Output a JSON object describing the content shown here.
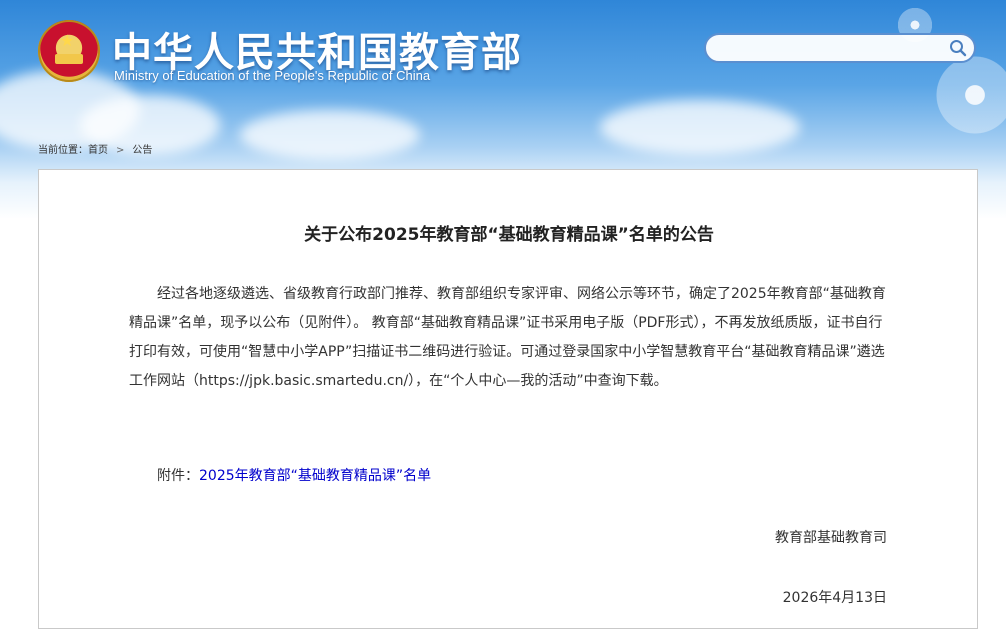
{
  "header": {
    "site_title": "中华人民共和国教育部",
    "site_subtitle": "Ministry of Education of the People's Republic of China",
    "search_placeholder": ""
  },
  "breadcrumb": {
    "prefix": "当前位置：",
    "home": "首页",
    "separator": ">",
    "current": "公告"
  },
  "article": {
    "title": "关于公布2025年教育部“基础教育精品课”名单的公告",
    "body": "经过各地逐级遴选、省级教育行政部门推荐、教育部组织专家评审、网络公示等环节，确定了2025年教育部“基础教育精品课”名单，现予以公布（见附件）。 教育部“基础教育精品课”证书采用电子版（PDF形式），不再发放纸质版，证书自行打印有效，可使用“智慧中小学APP”扫描证书二维码进行验证。可通过登录国家中小学智慧教育平台“基础教育精品课”遴选工作网站（https://jpk.basic.smartedu.cn/），在“个人中心—我的活动”中查询下载。",
    "attachment_label": "附件：",
    "attachment_link": "2025年教育部“基础教育精品课”名单",
    "signature": "教育部基础教育司",
    "date": "2026年4月13日"
  },
  "colors": {
    "header_blue": "#2f86d8",
    "link": "#0000cc",
    "text": "#333333"
  },
  "icons": {
    "search": "search-icon",
    "emblem": "national-emblem"
  }
}
